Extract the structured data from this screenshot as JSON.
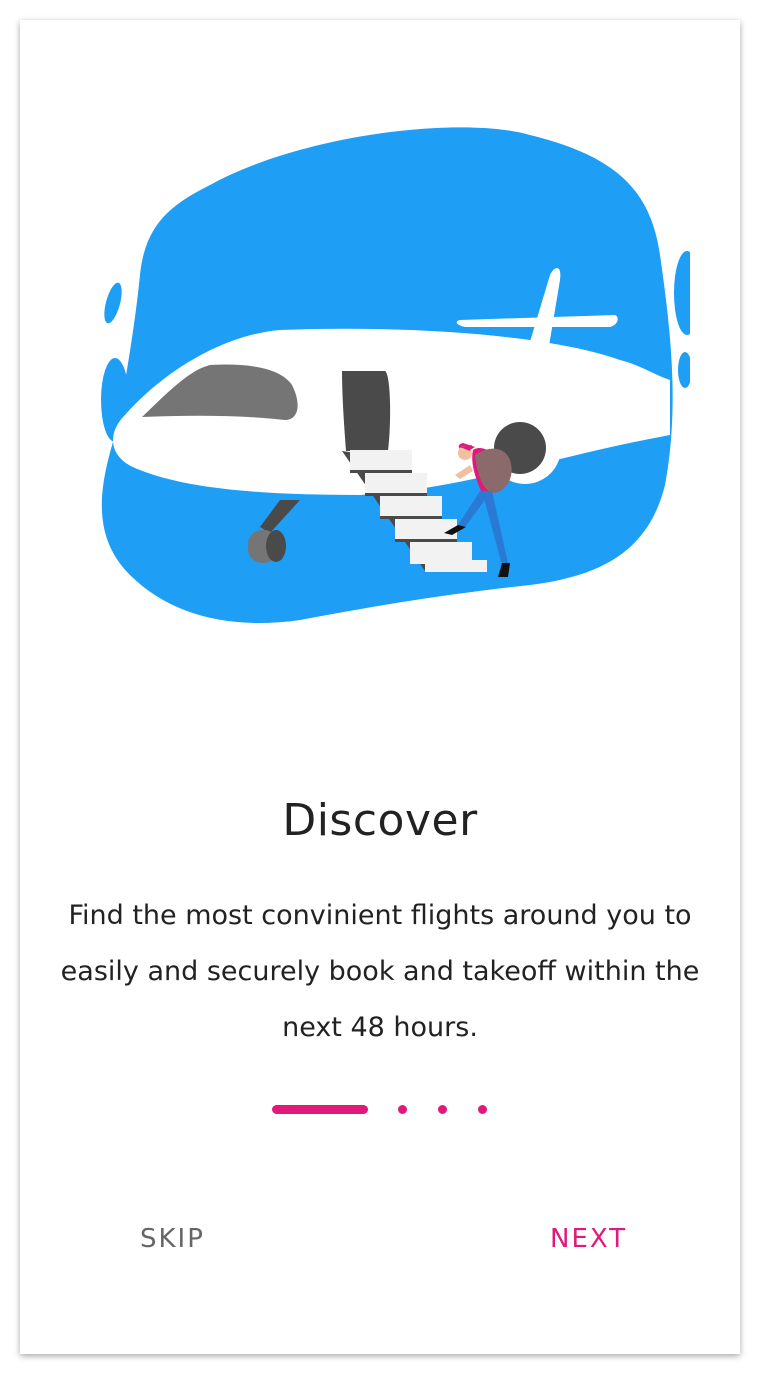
{
  "onboarding": {
    "title": "Discover",
    "description": "Find the most convinient flights around you to easily and securely book and takeoff within the next 48 hours.",
    "pager": {
      "total": 4,
      "active_index": 0
    },
    "skip_label": "SKIP",
    "next_label": "NEXT"
  },
  "colors": {
    "accent": "#e0197a",
    "skip_text": "#666666",
    "illustration_blue": "#1e9ff5",
    "text": "#222222"
  },
  "illustration": {
    "icon": "airplane-boarding-illustration"
  }
}
